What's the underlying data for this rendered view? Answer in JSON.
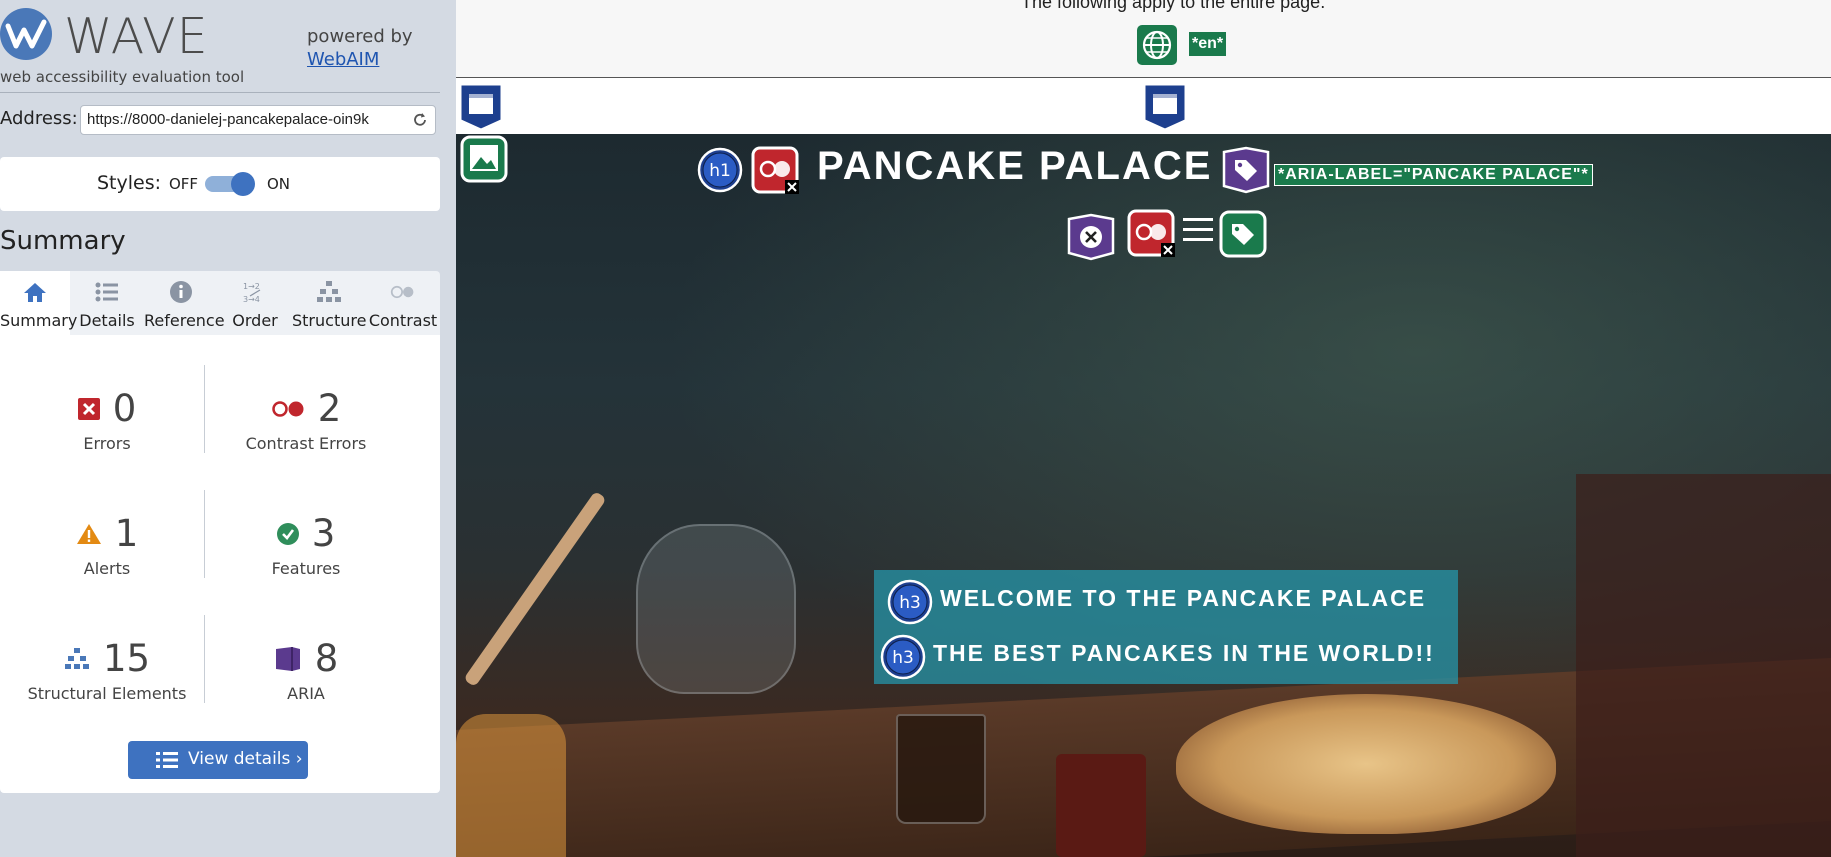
{
  "app": {
    "logo_text": "WAVE",
    "tagline": "web accessibility evaluation tool",
    "powered_by": "powered by",
    "webaim_link": "WebAIM"
  },
  "address": {
    "label": "Address:",
    "value": "https://8000-danielej-pancakepalace-oin9k"
  },
  "styles": {
    "label": "Styles:",
    "off": "OFF",
    "on": "ON",
    "enabled": true
  },
  "summary": {
    "title": "Summary",
    "tabs": [
      {
        "label": "Summary",
        "icon": "home-icon",
        "active": true
      },
      {
        "label": "Details",
        "icon": "list-icon",
        "active": false
      },
      {
        "label": "Reference",
        "icon": "info-icon",
        "active": false
      },
      {
        "label": "Order",
        "icon": "order-icon",
        "active": false
      },
      {
        "label": "Structure",
        "icon": "structure-icon",
        "active": false
      },
      {
        "label": "Contrast",
        "icon": "contrast-icon",
        "active": false
      }
    ],
    "stats": {
      "errors": {
        "count": "0",
        "label": "Errors"
      },
      "contrast_errors": {
        "count": "2",
        "label": "Contrast Errors"
      },
      "alerts": {
        "count": "1",
        "label": "Alerts"
      },
      "features": {
        "count": "3",
        "label": "Features"
      },
      "structural": {
        "count": "15",
        "label": "Structural Elements"
      },
      "aria": {
        "count": "8",
        "label": "ARIA"
      }
    },
    "view_details": "View details ›"
  },
  "page": {
    "doc_notice": "The following apply to the entire page.",
    "lang_tag": "*en*",
    "site_title": "PANCAKE PALACE",
    "aria_label_tag": "*ARIA-LABEL=\"PANCAKE PALACE\"*",
    "heading_welcome": "WELCOME TO THE PANCAKE PALACE",
    "heading_best": "THE BEST PANCAKES IN THE WORLD!!",
    "h1_badge": "h1",
    "h3_badge": "h3"
  },
  "colors": {
    "accent_blue": "#3e72c0",
    "error_red": "#c0262d",
    "feature_green": "#1a7a4c",
    "aria_purple": "#5b3a8e",
    "alert_orange": "#e38a13"
  }
}
